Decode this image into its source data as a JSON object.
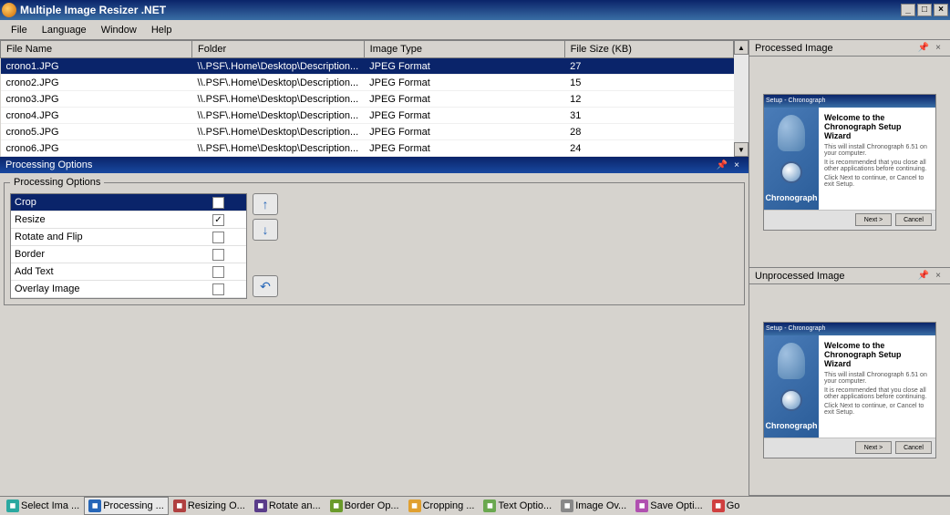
{
  "title": "Multiple Image Resizer .NET",
  "menu": [
    "File",
    "Language",
    "Window",
    "Help"
  ],
  "table": {
    "headers": [
      "File Name",
      "Folder",
      "Image Type",
      "File Size (KB)"
    ],
    "rows": [
      {
        "name": "crono1.JPG",
        "folder": "\\\\.PSF\\.Home\\Desktop\\Description...",
        "type": "JPEG Format",
        "size": "27",
        "selected": true
      },
      {
        "name": "crono2.JPG",
        "folder": "\\\\.PSF\\.Home\\Desktop\\Description...",
        "type": "JPEG Format",
        "size": "15",
        "selected": false
      },
      {
        "name": "crono3.JPG",
        "folder": "\\\\.PSF\\.Home\\Desktop\\Description...",
        "type": "JPEG Format",
        "size": "12",
        "selected": false
      },
      {
        "name": "crono4.JPG",
        "folder": "\\\\.PSF\\.Home\\Desktop\\Description...",
        "type": "JPEG Format",
        "size": "31",
        "selected": false
      },
      {
        "name": "crono5.JPG",
        "folder": "\\\\.PSF\\.Home\\Desktop\\Description...",
        "type": "JPEG Format",
        "size": "28",
        "selected": false
      },
      {
        "name": "crono6.JPG",
        "folder": "\\\\.PSF\\.Home\\Desktop\\Description...",
        "type": "JPEG Format",
        "size": "24",
        "selected": false
      }
    ]
  },
  "proc_panel": {
    "title": "Processing Options",
    "legend": "Processing Options",
    "rows": [
      {
        "label": "Crop",
        "checked": false,
        "selected": true
      },
      {
        "label": "Resize",
        "checked": true,
        "selected": false
      },
      {
        "label": "Rotate and Flip",
        "checked": false,
        "selected": false
      },
      {
        "label": "Border",
        "checked": false,
        "selected": false
      },
      {
        "label": "Add Text",
        "checked": false,
        "selected": false
      },
      {
        "label": "Overlay Image",
        "checked": false,
        "selected": false
      }
    ]
  },
  "previews": {
    "processed": {
      "title": "Processed Image"
    },
    "unprocessed": {
      "title": "Unprocessed Image"
    },
    "wizard": {
      "bar": "Setup - Chronograph",
      "welcome": "Welcome to the Chronograph Setup Wizard",
      "line1": "This will install Chronograph 6.51 on your computer.",
      "line2": "It is recommended that you close all other applications before continuing.",
      "line3": "Click Next to continue, or Cancel to exit Setup.",
      "brand": "Chronograph",
      "next": "Next >",
      "cancel": "Cancel"
    }
  },
  "tabs": [
    {
      "label": "Select Ima ...",
      "color": "#2aa8a0",
      "active": false
    },
    {
      "label": "Processing ...",
      "color": "#2666b8",
      "active": true
    },
    {
      "label": "Resizing O...",
      "color": "#b04040",
      "active": false
    },
    {
      "label": "Rotate an...",
      "color": "#5a3c8a",
      "active": false
    },
    {
      "label": "Border Op...",
      "color": "#6a9a2a",
      "active": false
    },
    {
      "label": "Cropping ...",
      "color": "#e0a030",
      "active": false
    },
    {
      "label": "Text Optio...",
      "color": "#6aa84f",
      "active": false
    },
    {
      "label": "Image Ov...",
      "color": "#888888",
      "active": false
    },
    {
      "label": "Save Opti...",
      "color": "#b050b0",
      "active": false
    },
    {
      "label": "Go",
      "color": "#d04040",
      "active": false
    }
  ]
}
